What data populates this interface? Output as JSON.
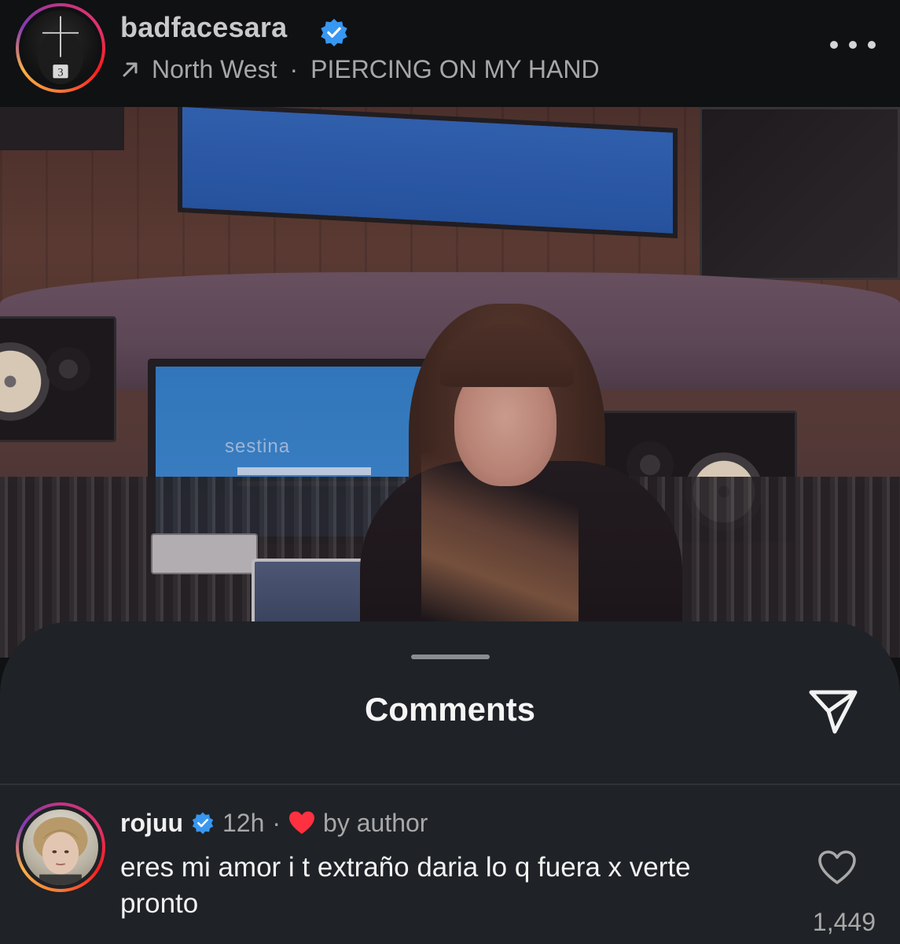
{
  "post": {
    "username": "badfacesara",
    "verified": true,
    "avatar_digit": "3",
    "audio_artist": "North West",
    "audio_separator": "·",
    "audio_title": "PIERCING ON MY HAND",
    "image_screen_text": "sestina"
  },
  "comments_sheet": {
    "title": "Comments",
    "comments": [
      {
        "username": "rojuu",
        "verified": true,
        "time": "12h",
        "separator": "·",
        "liked_by_author_label": "by author",
        "text": "eres mi amor i t extraño daria lo q fuera x verte pronto",
        "like_count": "1,449"
      }
    ]
  },
  "icons": {
    "header": [
      "verified-badge-icon",
      "arrow-up-right-icon",
      "more-horizontal-icon"
    ],
    "sheet": [
      "share-icon",
      "heart-filled-icon",
      "heart-outline-icon"
    ]
  },
  "colors": {
    "background": "#0f1113",
    "sheet": "#1f2226",
    "verified": "#3897f0",
    "heart": "#ff3040",
    "muted_text": "#a8a8a8"
  }
}
